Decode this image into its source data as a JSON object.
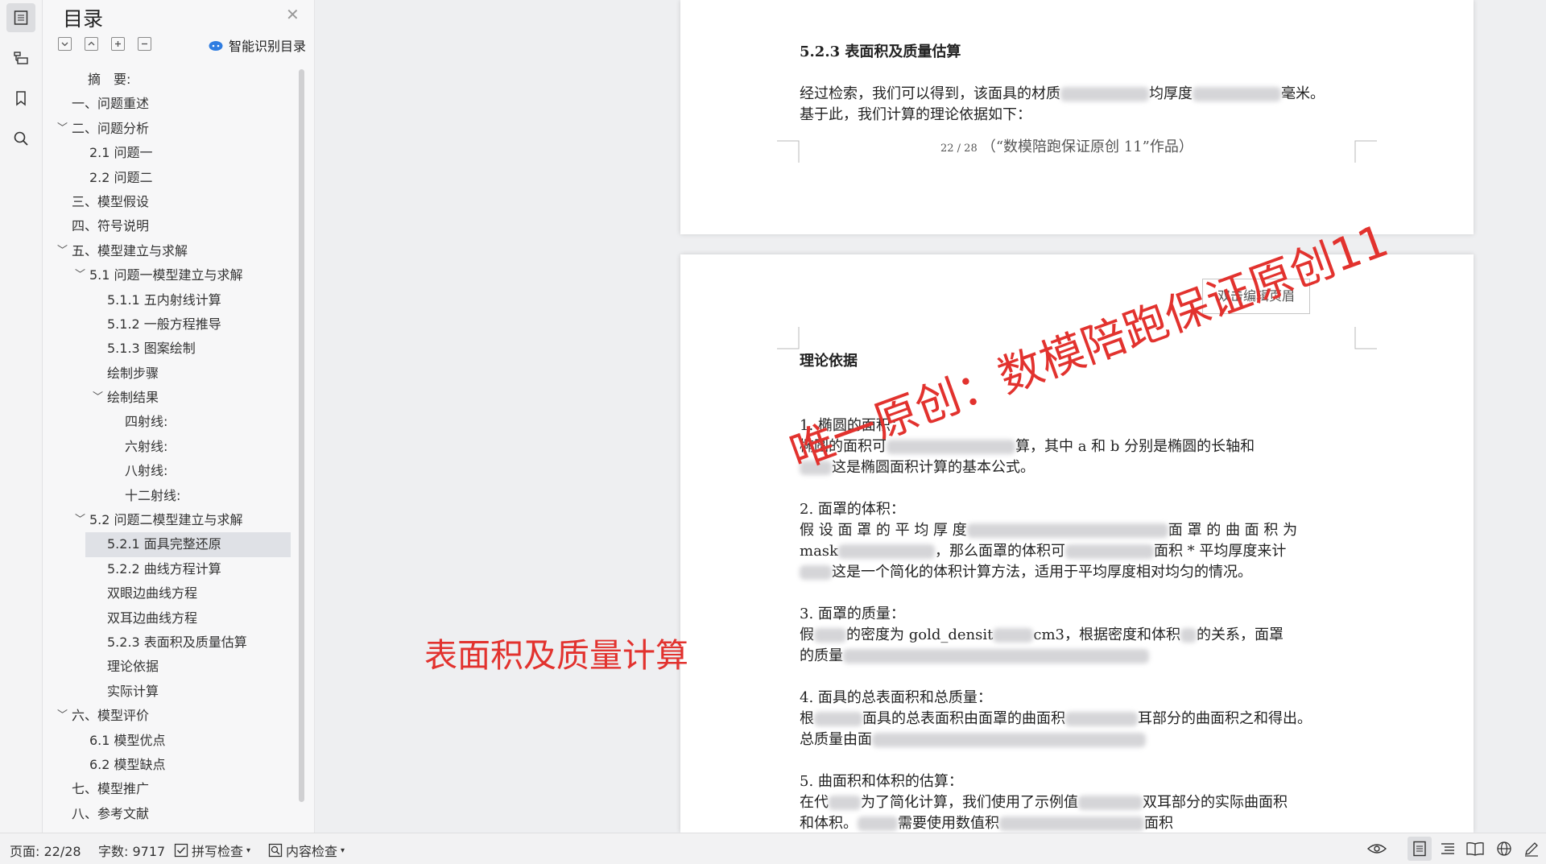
{
  "toc": {
    "title": "目录",
    "smart_label": "智能识别目录",
    "items": [
      {
        "label": "摘　要:"
      },
      {
        "label": "一、问题重述"
      },
      {
        "label": "二、问题分析"
      },
      {
        "label": "2.1 问题一"
      },
      {
        "label": "2.2 问题二"
      },
      {
        "label": "三、模型假设"
      },
      {
        "label": "四、符号说明"
      },
      {
        "label": "五、模型建立与求解"
      },
      {
        "label": "5.1 问题一模型建立与求解"
      },
      {
        "label": "5.1.1 五内射线计算"
      },
      {
        "label": "5.1.2 一般方程推导"
      },
      {
        "label": "5.1.3 图案绘制"
      },
      {
        "label": "绘制步骤"
      },
      {
        "label": "绘制结果"
      },
      {
        "label": "四射线:"
      },
      {
        "label": "六射线:"
      },
      {
        "label": "八射线:"
      },
      {
        "label": "十二射线:"
      },
      {
        "label": "5.2 问题二模型建立与求解"
      },
      {
        "label": "5.2.1 面具完整还原"
      },
      {
        "label": "5.2.2 曲线方程计算"
      },
      {
        "label": "双眼边曲线方程"
      },
      {
        "label": "双耳边曲线方程"
      },
      {
        "label": "5.2.3 表面积及质量估算"
      },
      {
        "label": "理论依据"
      },
      {
        "label": "实际计算"
      },
      {
        "label": "六、模型评价"
      },
      {
        "label": "6.1 模型优点"
      },
      {
        "label": "6.2 模型缺点"
      },
      {
        "label": "七、模型推广"
      },
      {
        "label": "八、参考文献"
      }
    ]
  },
  "page1": {
    "heading": "5.2.3  表面积及质量估算",
    "line1a": "经过检索，我们可以得到，该面具的材质",
    "line1b": "均厚度",
    "line1c": "毫米。",
    "line2": "基于此，我们计算的理论依据如下：",
    "footer_page": "22 / 28",
    "footer_text": "（“数模陪跑保证原创 11”作品）"
  },
  "page2": {
    "header_button": "双击编辑页眉",
    "heading": "理论依据",
    "s1_title": "1.  椭圆的面积：",
    "s1_l1a": "椭圆的面积可",
    "s1_l1b": "算，其中 a 和 b 分别是椭圆的长轴和",
    "s1_l2": "这是椭圆面积计算的基本公式。",
    "s2_title": "2.  面罩的体积：",
    "s2_l1a": "假 设 面 罩 的 平 均 厚 度",
    "s2_l1b": "面 罩 的 曲 面 积 为",
    "s2_l2a": "mask",
    "s2_l2b": "，那么面罩的体积可",
    "s2_l2c": "面积 * 平均厚度来计",
    "s2_l3": "这是一个简化的体积计算方法，适用于平均厚度相对均匀的情况。",
    "s3_title": "3.  面罩的质量：",
    "s3_l1a": "假",
    "s3_l1b": "的密度为 gold_densit",
    "s3_l1c": "cm3，根据密度和体积",
    "s3_l1d": "的关系，面罩",
    "s3_l2a": "的质量",
    "s4_title": "4.  面具的总表面积和总质量：",
    "s4_l1a": "根",
    "s4_l1b": "面具的总表面积由面罩的曲面积",
    "s4_l1c": "耳部分的曲面积之和得出。",
    "s4_l2a": "总质量由面",
    "s5_title": "5.  曲面积和体积的估算：",
    "s5_l1a": "在代",
    "s5_l1b": "为了简化计算，我们使用了示例值",
    "s5_l1c": "双耳部分的实际曲面积",
    "s5_l2a": "和体积。",
    "s5_l2b": "需要使用数值积",
    "s5_l2c": "面积"
  },
  "overlay": {
    "watermark": "唯一原创：数模陪跑保证原创11",
    "caption": "表面积及质量计算"
  },
  "status": {
    "page": "页面: 22/28",
    "words": "字数: 9717",
    "spell": "拼写检查",
    "content": "内容检查"
  },
  "colors": {
    "accent_red": "#e2322e",
    "selected_row": "#dfe1e6",
    "smart_icon": "#2f7de1"
  }
}
